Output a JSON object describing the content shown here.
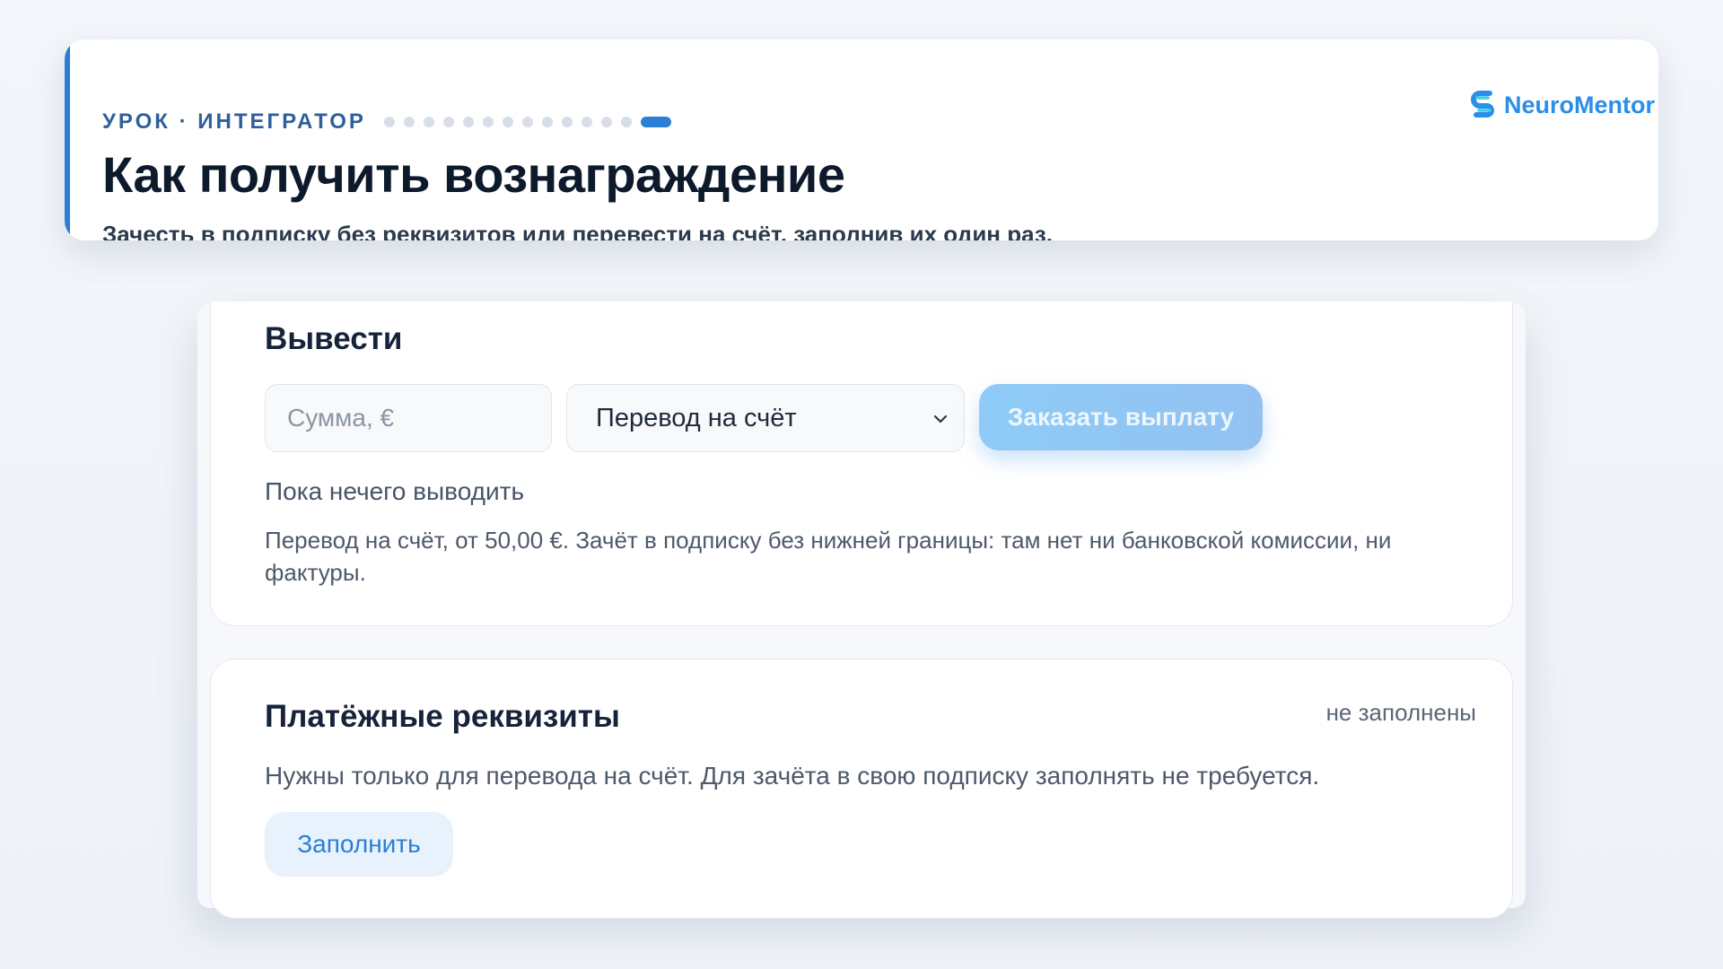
{
  "header": {
    "eyebrow": "УРОК · ИНТЕГРАТОР",
    "progress": {
      "total_steps": 14,
      "current_step": 14
    },
    "title": "Как получить вознаграждение",
    "subtitle": "Зачесть в подписку без реквизитов или перевести на счёт, заполнив их один раз.",
    "brand_name": "NeuroMentor"
  },
  "withdraw": {
    "title": "Вывести",
    "amount_placeholder": "Сумма, €",
    "method_selected": "Перевод на счёт",
    "payout_label": "Заказать выплату",
    "empty_note": "Пока нечего выводить",
    "rule_text": "Перевод на счёт, от 50,00 €. Зачёт в подписку без нижней границы: там нет ни банковской комиссии, ни фактуры."
  },
  "requisites": {
    "title": "Платёжные реквизиты",
    "status": "не заполнены",
    "description": "Нужны только для перевода на счёт. Для зачёта в свою подписку заполнять не требуется.",
    "fill_label": "Заполнить"
  },
  "colors": {
    "accent": "#2a7fd4",
    "brand": "#2b8ee8",
    "button_disabled": "#8ecbf6",
    "fill_button_bg": "#e7f2fc"
  },
  "icons": {
    "brand": "neuromentor-logo-icon",
    "select": "chevron-down-icon"
  }
}
